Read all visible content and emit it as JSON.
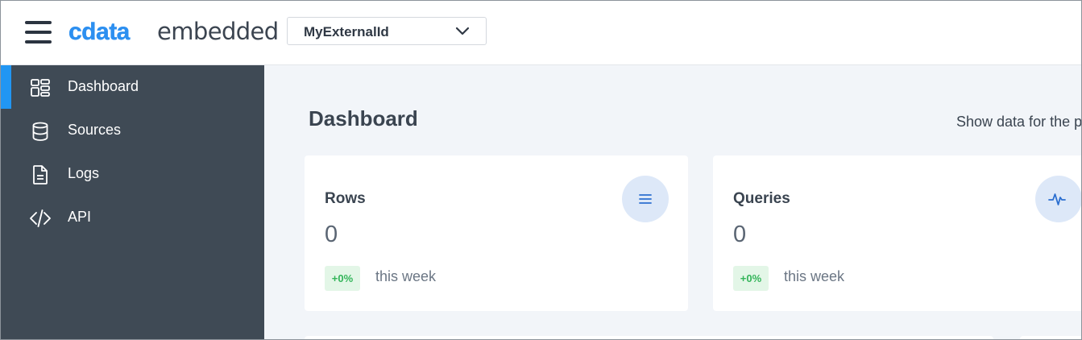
{
  "header": {
    "menu_icon": "hamburger-menu-icon",
    "logo_brand": "cdata",
    "logo_sub": "embedded",
    "account_select": {
      "value": "MyExternalId",
      "icon": "chevron-down-icon"
    }
  },
  "sidebar": {
    "accent_color": "#2196f3",
    "background_color": "#3f4a55",
    "items": [
      {
        "label": "Dashboard",
        "icon": "dashboard-grid-icon",
        "active": true
      },
      {
        "label": "Sources",
        "icon": "database-icon",
        "active": false
      },
      {
        "label": "Logs",
        "icon": "document-icon",
        "active": false
      },
      {
        "label": "API",
        "icon": "code-brackets-icon",
        "active": false
      }
    ]
  },
  "main": {
    "title": "Dashboard",
    "period_label": "Show data for the pa",
    "cards": [
      {
        "title": "Rows",
        "value": "0",
        "badge": "+0%",
        "period": "this week",
        "icon": "list-icon"
      },
      {
        "title": "Queries",
        "value": "0",
        "badge": "+0%",
        "period": "this week",
        "icon": "pulse-icon"
      }
    ]
  }
}
